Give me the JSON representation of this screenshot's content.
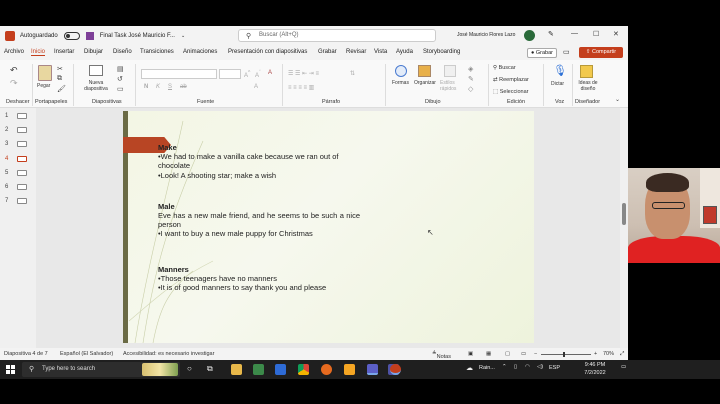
{
  "titlebar": {
    "autosave_label": "Autoguardado",
    "doc_title": "Final Task José Mauricio F...",
    "search_placeholder": "Buscar (Alt+Q)",
    "user_name": "José Mauricio Flores Lazo"
  },
  "menu": {
    "items": [
      "Archivo",
      "Inicio",
      "Insertar",
      "Dibujar",
      "Diseño",
      "Transiciones",
      "Animaciones",
      "Presentación con diapositivas",
      "Grabar",
      "Revisar",
      "Vista",
      "Ayuda",
      "Storyboarding"
    ],
    "active": "Inicio",
    "record_label": "Grabar",
    "share_label": "Compartir"
  },
  "ribbon": {
    "groups": [
      "Deshacer",
      "Portapapeles",
      "Diapositivas",
      "Fuente",
      "Párrafo",
      "Dibujo",
      "Edición",
      "Voz",
      "Diseñador"
    ],
    "paste_label": "Pegar",
    "new_slide_label": "Nueva diapositiva",
    "shapes_label": "Formas",
    "arrange_label": "Organizar",
    "quick_styles_label": "Estilos rápidos",
    "find_label": "Buscar",
    "replace_label": "Reemplazar",
    "select_label": "Seleccionar",
    "dictate_label": "Dictar",
    "design_ideas_label": "Ideas de diseño",
    "font_buttons": [
      "N",
      "K",
      "S",
      "ab",
      "A"
    ]
  },
  "thumbnails": [
    {
      "num": "1"
    },
    {
      "num": "2"
    },
    {
      "num": "3"
    },
    {
      "num": "4"
    },
    {
      "num": "5"
    },
    {
      "num": "6"
    },
    {
      "num": "7"
    }
  ],
  "current_slide": "4",
  "slide": {
    "sections": [
      {
        "heading": "Make",
        "lines": [
          "•We had to make a vanilla cake because we ran out of chocolate",
          "•Look! A shooting star; make a wish"
        ]
      },
      {
        "heading": "Male",
        "lines": [
          "Eve has a new male friend, and he seems to be such a nice person",
          "•I want to buy a new male puppy for Christmas"
        ]
      },
      {
        "heading": "Manners",
        "lines": [
          "•Those teenagers have no manners",
          "•It is of good manners to say thank you and please"
        ]
      }
    ]
  },
  "status": {
    "slide_info": "Diapositiva 4 de 7",
    "language": "Español (El Salvador)",
    "accessibility": "Accesibilidad: es necesario investigar",
    "notes_label": "Notas",
    "zoom": "70%"
  },
  "taskbar": {
    "search_text": "Type here to search",
    "weather": "Rain...",
    "lang": "ESP",
    "time": "9:46 PM",
    "date": "7/2/2022"
  },
  "colors": {
    "accent": "#c43e1c",
    "slide_ribbon": "#b84524",
    "taskbar": "#1f1f1f"
  }
}
